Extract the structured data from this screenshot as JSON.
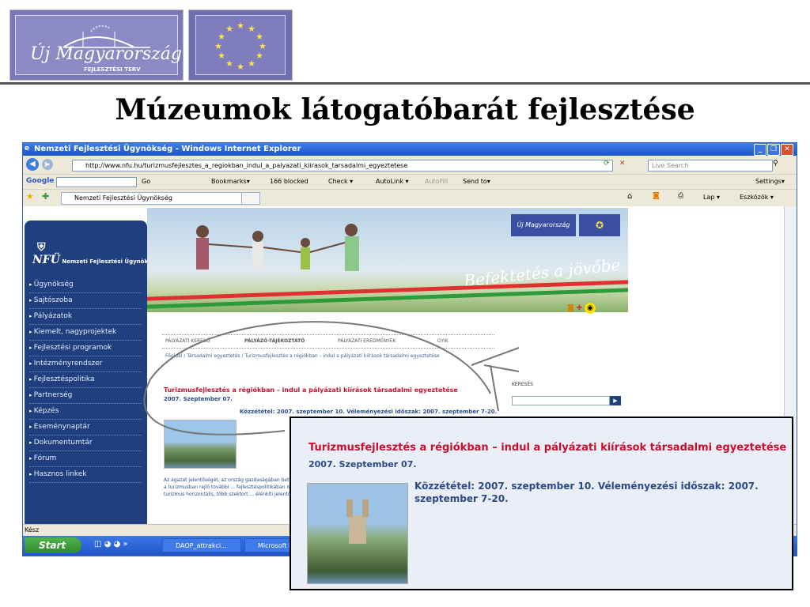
{
  "slide": {
    "title": "Múzeumok látogatóbarát fejlesztése",
    "logo_text": "Új Magyarország",
    "logo_sub": "FEJLESZTÉSI TERV"
  },
  "browser": {
    "window_title": "Nemzeti Fejlesztési Ügynökség - Windows Internet Explorer",
    "address": "http://www.nfu.hu/turizmusfejlesztes_a_regiokban_indul_a_palyazati_kiirasok_tarsadalmi_egyeztetese",
    "search_placeholder": "Live Search",
    "google_toolbar": {
      "brand": "Google",
      "go": "Go",
      "bookmarks": "Bookmarks▾",
      "blocked": "166 blocked",
      "check": "Check ▾",
      "autolink": "AutoLink ▾",
      "autofill": "AutoFill",
      "send_to": "Send to▾",
      "settings": "Settings▾"
    },
    "tab_label": "Nemzeti Fejlesztési Ügynökség",
    "tab_tools": "Lap ▾",
    "tab_tools2": "Eszközök ▾",
    "status": "Kész",
    "taskbar": {
      "start": "Start",
      "task1": "DAOP_attrakci...",
      "task2": "Microsoft Po"
    }
  },
  "site": {
    "logo_abbr": "NFÜ",
    "logo_name": "Nemzeti Fejlesztési Ügynökség",
    "nav": [
      "Ügynökség",
      "Sajtószoba",
      "Pályázatok",
      "Kiemelt, nagyprojektek",
      "Fejlesztési programok",
      "Intézményrendszer",
      "Fejlesztéspolitika",
      "Partnerség",
      "Képzés",
      "Eseménynaptár",
      "Dokumentumtár",
      "Fórum",
      "Hasznos linkek"
    ],
    "slogan": "Befektetés a jövőbe",
    "subnav": [
      "PÁLYÁZATI KERESŐ",
      "PÁLYÁZÓ-TÁJÉKOZTATÓ",
      "PÁLYÁZATI EREDMÉNYEK",
      "GYIK"
    ],
    "breadcrumb": "Főoldal / Társadalmi egyeztetés / Turizmusfejlesztés a régiókban – indul a pályázati kiírások társadalmi egyeztetése",
    "search_label": "KERESÉS",
    "body_text": "Az ágazat jelentőségét, az ország gazdaságában betöltött szerepét ... valamint a turizmusban rejlő további ... fejlesztéspolitikában is mind nagyobb ... A turizmus horizontális, több szektort ... élénkíti jelentős multiplikátor hatása ..."
  },
  "article": {
    "title": "Turizmusfejlesztés a régiókban – indul a pályázati kiírások társadalmi egyeztetése",
    "date": "2007. Szeptember 07.",
    "published": "Közzététel: 2007. szeptember 10. Véleményezési időszak: 2007. szeptember 7-20."
  }
}
